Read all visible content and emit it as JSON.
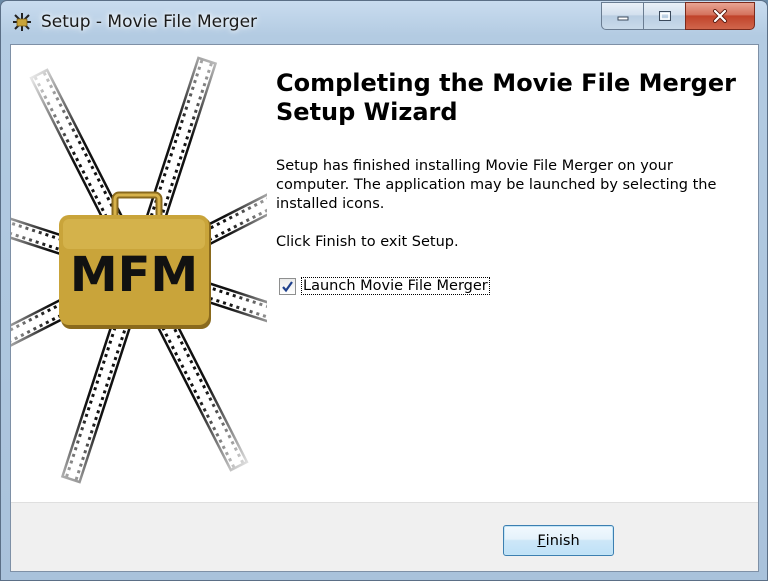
{
  "window": {
    "title": "Setup - Movie File Merger",
    "app_icon": "mfm-app-icon",
    "caption_buttons": [
      "minimize",
      "maximize",
      "close"
    ]
  },
  "banner": {
    "logo_text": "MFM",
    "colors": {
      "badge": "#c9a43a",
      "badge_dark": "#8a6a1d",
      "film": "#111111"
    }
  },
  "main": {
    "heading_line1": "Completing the Movie File Merger",
    "heading_line2": "Setup Wizard",
    "body_line1": "Setup has finished installing Movie File Merger on your",
    "body_line2": "computer. The application may be launched by selecting the",
    "body_line3": "installed icons.",
    "exit_text": "Click Finish to exit Setup.",
    "launch_checkbox": {
      "label": "Launch Movie File Merger",
      "checked": true
    }
  },
  "footer": {
    "finish_button": {
      "accel": "F",
      "rest": "inish"
    }
  }
}
